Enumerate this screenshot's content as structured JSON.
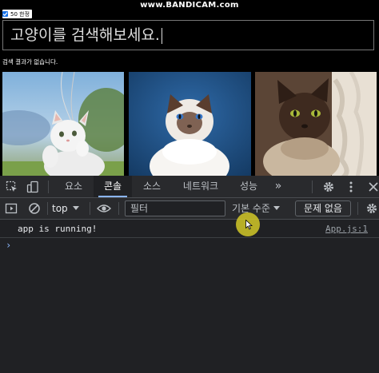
{
  "watermark": "www.BANDICAM.com",
  "app": {
    "limit_toggle": {
      "checked": true,
      "label": "50 한정"
    },
    "search": {
      "value": "고양이를 검색해보세요."
    },
    "status_message": "검색 결과가 없습니다.",
    "cats": [
      {
        "name": "white kitten",
        "colors": [
          "#8fb6d8",
          "#f2f2f2"
        ]
      },
      {
        "name": "birman cat",
        "colors": [
          "#1f4f82",
          "#ffffff"
        ]
      },
      {
        "name": "siamese cat",
        "colors": [
          "#6b4a35",
          "#efe9e0"
        ]
      }
    ]
  },
  "devtools": {
    "tabs": [
      {
        "label": "요소",
        "active": false
      },
      {
        "label": "콘솔",
        "active": true
      },
      {
        "label": "소스",
        "active": false
      },
      {
        "label": "네트워크",
        "active": false
      },
      {
        "label": "성능",
        "active": false
      }
    ],
    "more_tabs": "»",
    "context": "top",
    "filter_placeholder": "필터",
    "levels": "기본 수준",
    "issues_button": "문제 없음",
    "log": [
      {
        "message": "app is running!",
        "source": "App.js:1"
      }
    ],
    "prompt_symbol": "›"
  },
  "colors": {
    "devtools_bg": "#202124",
    "devtools_bar": "#292a2d",
    "accent": "#8ab4f8",
    "checkbox": "#1a73e8"
  },
  "icons": [
    "inspect-icon",
    "device-toggle-icon",
    "gear-icon",
    "kebab-menu-icon",
    "close-icon",
    "sidebar-toggle-icon",
    "clear-console-icon",
    "eye-icon",
    "dropdown-arrow-icon"
  ]
}
